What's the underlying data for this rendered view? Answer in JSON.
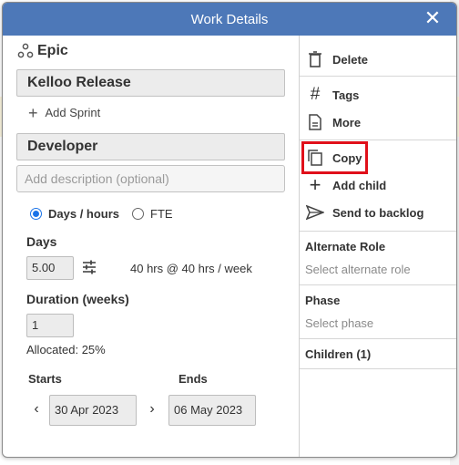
{
  "header": {
    "title": "Work Details"
  },
  "left": {
    "epic_label": "Epic",
    "epic_name": "Kelloo Release",
    "add_sprint": "Add Sprint",
    "role": "Developer",
    "description_placeholder": "Add description (optional)",
    "mode_options": [
      "Days / hours",
      "FTE"
    ],
    "selected_mode": "Days / hours",
    "days_label": "Days",
    "days_value": "5.00",
    "hours_text": "40 hrs @ 40 hrs / week",
    "duration_label": "Duration (weeks)",
    "duration_value": "1",
    "allocated_text": "Allocated: 25%",
    "starts_label": "Starts",
    "ends_label": "Ends",
    "start_date": "30 Apr 2023",
    "end_date": "06 May 2023"
  },
  "right": {
    "delete_label": "Delete",
    "tags_label": "Tags",
    "more_label": "More",
    "copy_label": "Copy",
    "add_child_label": "Add child",
    "send_backlog_label": "Send to backlog",
    "alternate_role_title": "Alternate Role",
    "alternate_role_placeholder": "Select alternate role",
    "phase_title": "Phase",
    "phase_placeholder": "Select phase",
    "children_label": "Children (1)"
  },
  "colors": {
    "header": "#4d78b8",
    "highlight": "#e0101a",
    "radio": "#1a73e8"
  }
}
